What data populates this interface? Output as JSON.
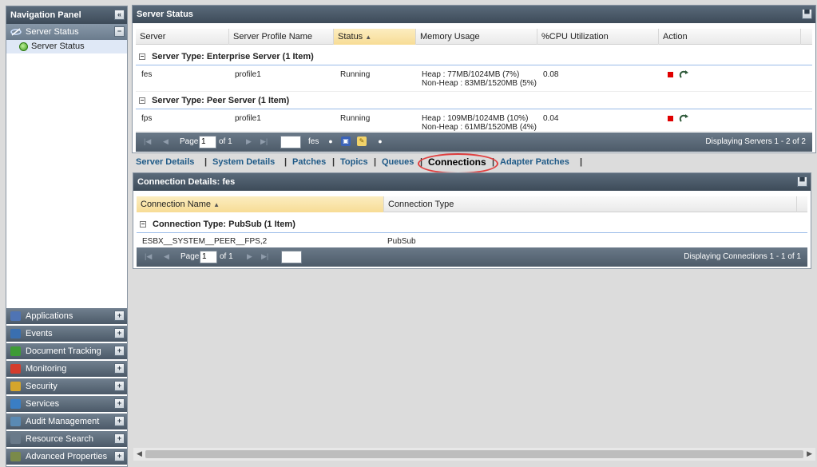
{
  "nav": {
    "title": "Navigation Panel",
    "open_section": {
      "label": "Server Status",
      "sub_item": "Server Status"
    },
    "items": [
      {
        "label": "Applications",
        "icon": "applications-icon",
        "color": "#4f74b4"
      },
      {
        "label": "Events",
        "icon": "events-icon",
        "color": "#3a6fb0"
      },
      {
        "label": "Document Tracking",
        "icon": "document-tracking-icon",
        "color": "#3e9b36"
      },
      {
        "label": "Monitoring",
        "icon": "monitoring-icon",
        "color": "#d43c2c"
      },
      {
        "label": "Security",
        "icon": "lock-icon",
        "color": "#d4a52c"
      },
      {
        "label": "Services",
        "icon": "services-icon",
        "color": "#3a7ec4"
      },
      {
        "label": "Audit Management",
        "icon": "audit-icon",
        "color": "#5a8ab4"
      },
      {
        "label": "Resource Search",
        "icon": "search-icon",
        "color": "#6a7a8a"
      },
      {
        "label": "Advanced Properties",
        "icon": "properties-icon",
        "color": "#7a8a4a"
      }
    ]
  },
  "server_panel": {
    "title": "Server Status",
    "columns": [
      "Server",
      "Server Profile Name",
      "Status",
      "Memory Usage",
      "%CPU Utilization",
      "Action"
    ],
    "groups": [
      {
        "label": "Server Type: Enterprise Server (1 Item)",
        "rows": [
          {
            "server": "fes",
            "profile": "profile1",
            "status": "Running",
            "heap": "Heap : 77MB/1024MB (7%)",
            "nonheap": "Non-Heap : 83MB/1520MB (5%)",
            "cpu": "0.08"
          }
        ]
      },
      {
        "label": "Server Type: Peer Server (1 Item)",
        "rows": [
          {
            "server": "fps",
            "profile": "profile1",
            "status": "Running",
            "heap": "Heap : 109MB/1024MB (10%)",
            "nonheap": "Non-Heap : 61MB/1520MB (4%)",
            "cpu": "0.04"
          }
        ]
      }
    ],
    "pager": {
      "page_label": "Page",
      "page": "1",
      "of": "of 1",
      "selected": "fes",
      "display": "Displaying Servers 1 - 2 of 2"
    }
  },
  "tabs": [
    {
      "label": "Server Details",
      "active": false
    },
    {
      "label": "System Details",
      "active": false
    },
    {
      "label": "Patches",
      "active": false
    },
    {
      "label": "Topics",
      "active": false
    },
    {
      "label": "Queues",
      "active": false
    },
    {
      "label": "Connections",
      "active": true
    },
    {
      "label": "Adapter Patches",
      "active": false
    }
  ],
  "conn_panel": {
    "title": "Connection Details: fes",
    "columns": [
      "Connection Name",
      "Connection Type"
    ],
    "group": "Connection Type: PubSub (1 Item)",
    "rows": [
      {
        "name": "ESBX__SYSTEM__PEER__FPS,2",
        "type": "PubSub"
      }
    ],
    "pager": {
      "page_label": "Page",
      "page": "1",
      "of": "of 1",
      "display": "Displaying Connections 1 - 1 of 1"
    }
  }
}
